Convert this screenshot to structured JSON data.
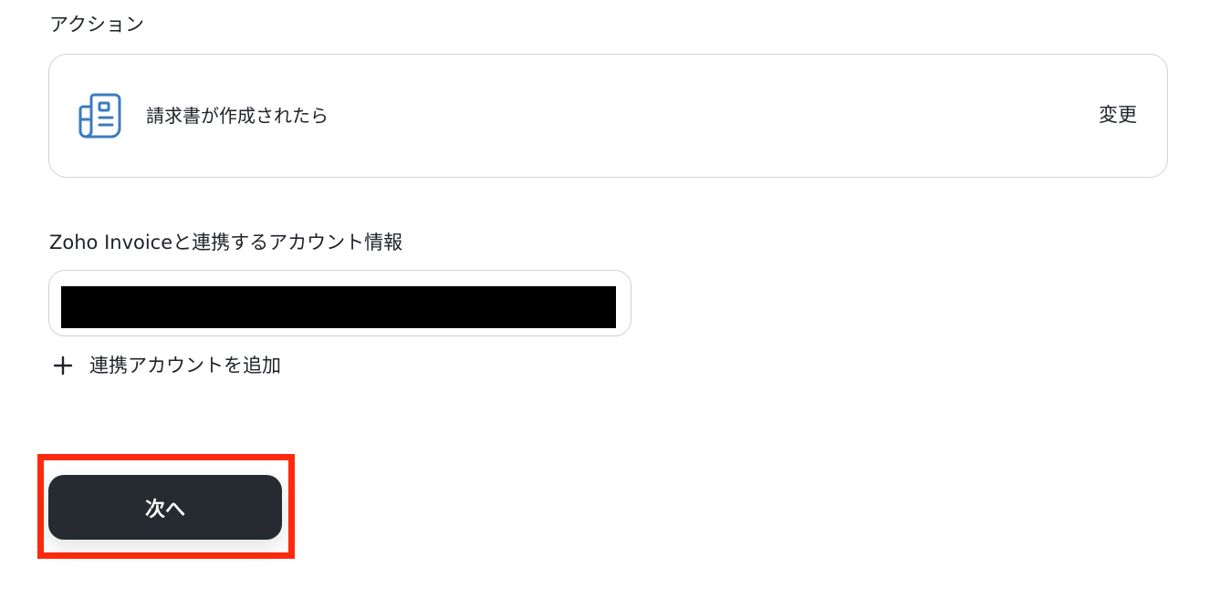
{
  "action": {
    "section_label": "アクション",
    "title": "請求書が作成されたら",
    "change_label": "変更",
    "icon": "invoice-document-icon",
    "icon_color": "#3b7bbf"
  },
  "account": {
    "section_label": "Zoho Invoiceと連携するアカウント情報",
    "add_label": "連携アカウントを追加",
    "add_icon": "plus-icon"
  },
  "footer": {
    "next_label": "次へ",
    "highlight_color": "#ff2a0e"
  }
}
